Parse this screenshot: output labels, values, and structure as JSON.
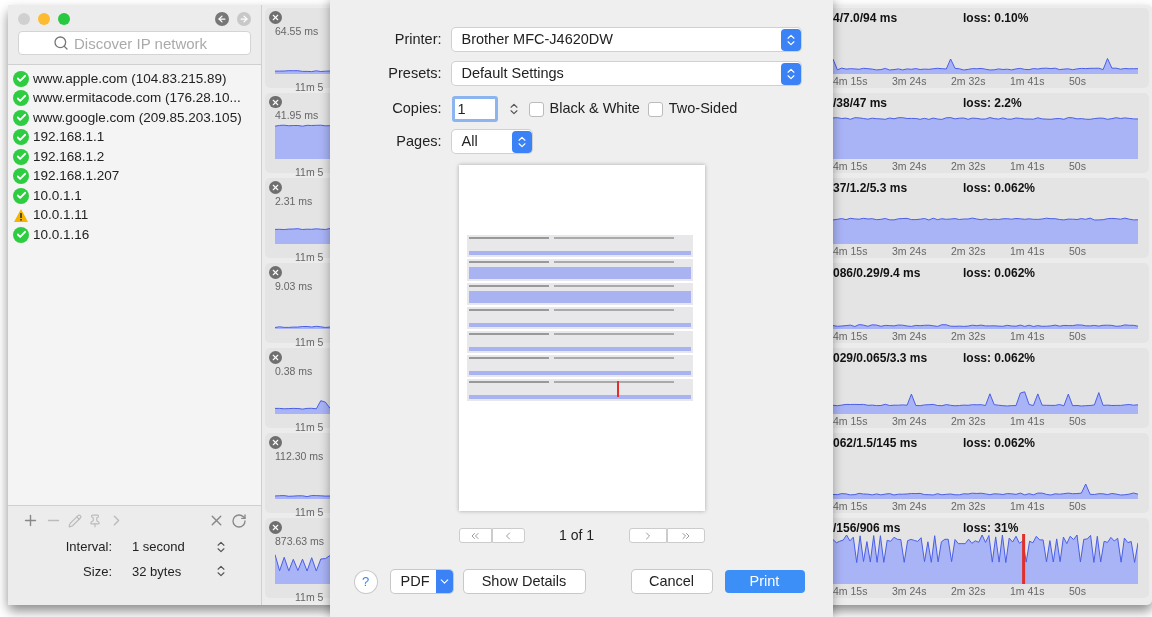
{
  "sidebar": {
    "search": {
      "placeholder": "Discover IP network"
    },
    "hosts": [
      {
        "label": "www.apple.com (104.83.215.89)",
        "kind": "ok"
      },
      {
        "label": "www.ermitacode.com (176.28.10...",
        "kind": "ok"
      },
      {
        "label": "www.google.com (209.85.203.105)",
        "kind": "ok"
      },
      {
        "label": "192.168.1.1",
        "kind": "ok"
      },
      {
        "label": "192.168.1.2",
        "kind": "ok"
      },
      {
        "label": "192.168.1.207",
        "kind": "ok"
      },
      {
        "label": "10.0.1.1",
        "kind": "ok"
      },
      {
        "label": "10.0.1.11",
        "kind": "warning"
      },
      {
        "label": "10.0.1.16",
        "kind": "ok"
      }
    ],
    "settings": [
      {
        "label": "Interval:",
        "value": "1 second"
      },
      {
        "label": "Size:",
        "value": "32 bytes"
      }
    ]
  },
  "graphs": [
    {
      "max": "64.55 ms",
      "left_tick": "11m 5",
      "stats": "4/7.0/94 ms",
      "loss": "loss: 0.10%",
      "ticks": [
        "4m 15s",
        "3m 24s",
        "2m 32s",
        "1m 41s",
        "50s"
      ]
    },
    {
      "max": "41.95 ms",
      "left_tick": "11m 5",
      "stats": "/38/47 ms",
      "loss": "loss: 2.2%",
      "ticks": [
        "4m 15s",
        "3m 24s",
        "2m 32s",
        "1m 41s",
        "50s"
      ]
    },
    {
      "max": "2.31 ms",
      "left_tick": "11m 5",
      "stats": "37/1.2/5.3 ms",
      "loss": "loss: 0.062%",
      "ticks": [
        "4m 15s",
        "3m 24s",
        "2m 32s",
        "1m 41s",
        "50s"
      ]
    },
    {
      "max": "9.03 ms",
      "left_tick": "11m 5",
      "stats": "086/0.29/9.4 ms",
      "loss": "loss: 0.062%",
      "ticks": [
        "4m 15s",
        "3m 24s",
        "2m 32s",
        "1m 41s",
        "50s"
      ]
    },
    {
      "max": "0.38 ms",
      "left_tick": "11m 5",
      "stats": "029/0.065/3.3 ms",
      "loss": "loss: 0.062%",
      "ticks": [
        "4m 15s",
        "3m 24s",
        "2m 32s",
        "1m 41s",
        "50s"
      ]
    },
    {
      "max": "112.30 ms",
      "left_tick": "11m 5",
      "stats": "062/1.5/145 ms",
      "loss": "loss: 0.062%",
      "ticks": [
        "4m 15s",
        "3m 24s",
        "2m 32s",
        "1m 41s",
        "50s"
      ]
    },
    {
      "max": "873.63 ms",
      "left_tick": "11m 5",
      "stats": "/156/906 ms",
      "loss": "loss: 31%",
      "ticks": [
        "4m 15s",
        "3m 24s",
        "2m 32s",
        "1m 41s",
        "50s"
      ]
    }
  ],
  "print_dialog": {
    "printer": {
      "label": "Printer:",
      "value": "Brother MFC-J4620DW"
    },
    "presets": {
      "label": "Presets:",
      "value": "Default Settings"
    },
    "copies": {
      "label": "Copies:",
      "value": "1"
    },
    "options": [
      {
        "label": "Black & White",
        "checked": false
      },
      {
        "label": "Two-Sided",
        "checked": false
      }
    ],
    "pages": {
      "label": "Pages:",
      "value": "All"
    },
    "page_counter": "1 of 1",
    "help": "?",
    "pdf": "PDF",
    "buttons": [
      {
        "label": "Show Details",
        "kind": "normal"
      },
      {
        "label": "Cancel",
        "kind": "normal"
      },
      {
        "label": "Print",
        "kind": "default"
      }
    ]
  }
}
